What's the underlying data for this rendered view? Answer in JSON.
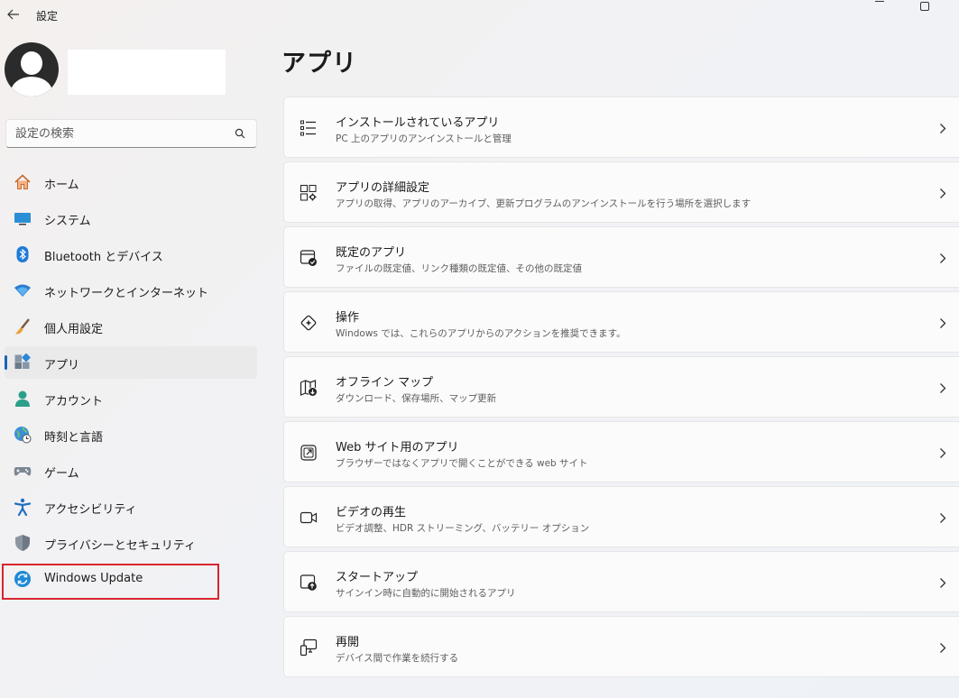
{
  "window": {
    "title": "設定"
  },
  "search": {
    "placeholder": "設定の検索"
  },
  "nav": {
    "items": [
      {
        "label": "ホーム",
        "icon": "home-icon"
      },
      {
        "label": "システム",
        "icon": "system-icon"
      },
      {
        "label": "Bluetooth とデバイス",
        "icon": "bluetooth-icon"
      },
      {
        "label": "ネットワークとインターネット",
        "icon": "wifi-icon"
      },
      {
        "label": "個人用設定",
        "icon": "brush-icon"
      },
      {
        "label": "アプリ",
        "icon": "apps-icon",
        "selected": true
      },
      {
        "label": "アカウント",
        "icon": "account-icon"
      },
      {
        "label": "時刻と言語",
        "icon": "globe-clock-icon"
      },
      {
        "label": "ゲーム",
        "icon": "gamepad-icon"
      },
      {
        "label": "アクセシビリティ",
        "icon": "accessibility-icon"
      },
      {
        "label": "プライバシーとセキュリティ",
        "icon": "shield-icon"
      },
      {
        "label": "Windows Update",
        "icon": "update-icon"
      }
    ]
  },
  "main": {
    "title": "アプリ",
    "cards": [
      {
        "title": "インストールされているアプリ",
        "subtitle": "PC 上のアプリのアンインストールと管理",
        "icon": "list-icon"
      },
      {
        "title": "アプリの詳細設定",
        "subtitle": "アプリの取得、アプリのアーカイブ、更新プログラムのアンインストールを行う場所を選択します",
        "icon": "app-settings-icon"
      },
      {
        "title": "既定のアプリ",
        "subtitle": "ファイルの既定値、リンク種類の既定値、その他の既定値",
        "icon": "default-apps-icon"
      },
      {
        "title": "操作",
        "subtitle": "Windows では、これらのアプリからのアクションを推奨できます。",
        "icon": "actions-icon"
      },
      {
        "title": "オフライン マップ",
        "subtitle": "ダウンロード、保存場所、マップ更新",
        "icon": "map-download-icon"
      },
      {
        "title": "Web サイト用のアプリ",
        "subtitle": "ブラウザーではなくアプリで開くことができる web サイト",
        "icon": "open-external-icon"
      },
      {
        "title": "ビデオの再生",
        "subtitle": "ビデオ調整、HDR ストリーミング、バッテリー オプション",
        "icon": "video-icon"
      },
      {
        "title": "スタートアップ",
        "subtitle": "サインイン時に自動的に開始されるアプリ",
        "icon": "startup-icon"
      },
      {
        "title": "再開",
        "subtitle": "デバイス間で作業を続行する",
        "icon": "resume-icon"
      }
    ]
  },
  "colors": {
    "accent": "#1f62b5",
    "highlight_border": "#d8252d"
  }
}
